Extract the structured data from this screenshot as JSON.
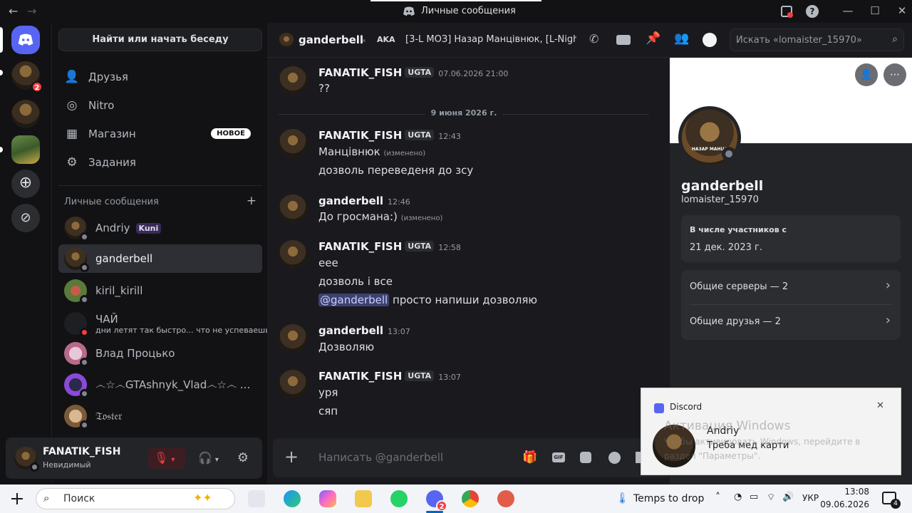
{
  "window": {
    "title": "Личные сообщения",
    "back": "←",
    "forward": "→",
    "minimize": "—",
    "maximize": "☐",
    "close": "✕",
    "help": "?"
  },
  "rail": {
    "servers": [
      {
        "badge": "2"
      },
      {},
      {}
    ]
  },
  "sidebar": {
    "find_label": "Найти или начать беседу",
    "nav": [
      {
        "label": "Друзья",
        "icon": "friends-icon"
      },
      {
        "label": "Nitro",
        "icon": "nitro-icon"
      },
      {
        "label": "Магазин",
        "icon": "shop-icon",
        "badge": "НОВОЕ"
      },
      {
        "label": "Задания",
        "icon": "quests-icon"
      }
    ],
    "dm_header": "Личные сообщения",
    "dm_add": "+",
    "dms": [
      {
        "name": "Andriy",
        "tag": "Kuni"
      },
      {
        "name": "ganderbell"
      },
      {
        "name": "kiril_kirill"
      },
      {
        "name": "ЧАЙ",
        "sub": "дни летят так быстро... что не успеваешь..."
      },
      {
        "name": "Влад Процько"
      },
      {
        "name": "෴☆෴GTAshnyk_Vlad෴☆෴ ..."
      },
      {
        "name": "𝔗𝔬𝔰𝔱𝔢𝔯"
      }
    ]
  },
  "user": {
    "name": "FANATIK_FISH",
    "status": "Невидимый"
  },
  "header": {
    "name": "ganderbell",
    "aka_label": "AKA",
    "aka_text": "[3-L МОЗ] Назар Манцівнюк, [L-Nigh...",
    "search_placeholder": "Искать «lomaister_15970»"
  },
  "chat": {
    "divider": "9 июня 2026 г.",
    "messages": [
      {
        "author": "FANATIK_FISH",
        "tag": "UGTA",
        "time": "07.06.2026 21:00",
        "lines": [
          "??"
        ]
      },
      {
        "author": "FANATIK_FISH",
        "tag": "UGTA",
        "time": "12:43",
        "lines": [
          "Манцівнюк",
          "дозволь переведеня до зсу"
        ],
        "edited": "(изменено)"
      },
      {
        "author": "ganderbell",
        "time": "12:46",
        "lines": [
          "До гросмана:)"
        ],
        "edited": "(изменено)"
      },
      {
        "author": "FANATIK_FISH",
        "tag": "UGTA",
        "time": "12:58",
        "lines": [
          "еее",
          "дозволь і все",
          "просто напиши дозволяю"
        ],
        "mention": "@ganderbell"
      },
      {
        "author": "ganderbell",
        "time": "13:07",
        "lines": [
          "Дозволяю"
        ]
      },
      {
        "author": "FANATIK_FISH",
        "tag": "UGTA",
        "time": "13:07",
        "lines": [
          "уря",
          "сяп"
        ]
      }
    ],
    "composer_placeholder": "Написать @ganderbell"
  },
  "profile": {
    "display_name": "ganderbell",
    "username": "lomaister_15970",
    "member_since_label": "В числе участников с",
    "member_since": "21 дек. 2023 г.",
    "mutual_servers": "Общие серверы — 2",
    "mutual_friends": "Общие друзья — 2",
    "avatar_caption": "НАЗАР МАНЦЕ"
  },
  "toast": {
    "app": "Discord",
    "title": "Andriy",
    "body": "Треба мед карти",
    "watermark1": "Активация Windows",
    "watermark2": "Чтобы активировать Windows, перейдите в",
    "watermark3": "раздел \"Параметры\"."
  },
  "taskbar": {
    "search": "Поиск",
    "weather": "Temps to drop",
    "lang": "УКР",
    "time": "13:08",
    "date": "09.06.2026",
    "notif": "4",
    "discord_badge": "2"
  }
}
